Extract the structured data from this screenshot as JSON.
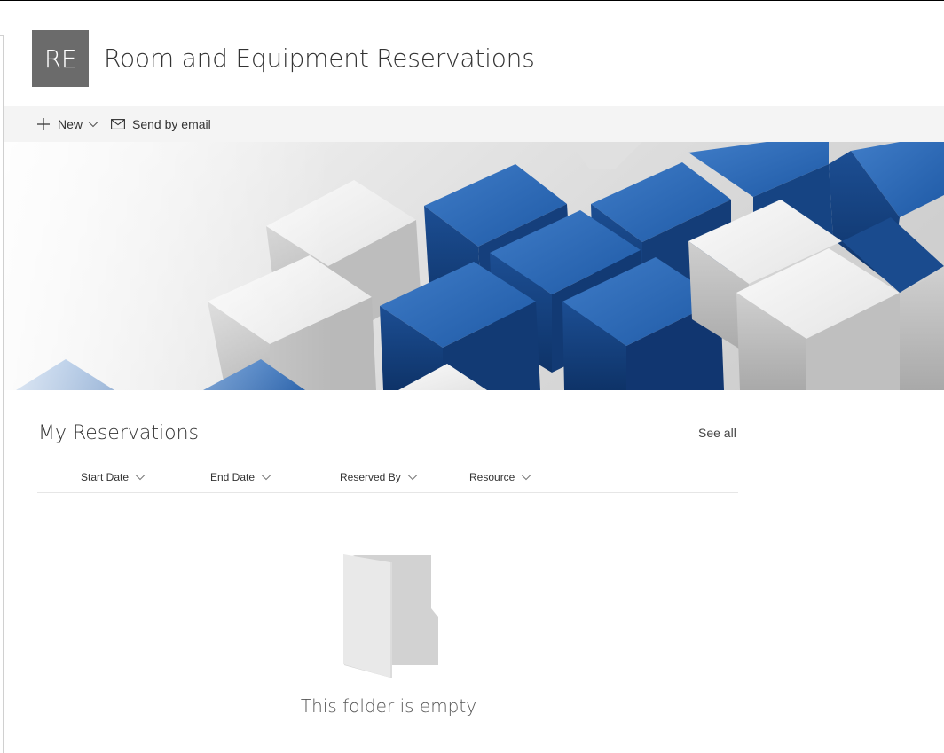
{
  "site": {
    "logo_initials": "RE",
    "title": "Room and Equipment Reservations",
    "logo_color": "#6b6b6b"
  },
  "command_bar": {
    "new_label": "New",
    "send_email_label": "Send by email",
    "icons": [
      "add-icon",
      "chevron-down-icon",
      "mail-icon"
    ]
  },
  "hero": {
    "image": "blue-and-white-cubes-banner",
    "colors": {
      "blue": "#1f5aa6",
      "white": "#e9e9e9"
    }
  },
  "reservations": {
    "title": "My Reservations",
    "see_all_label": "See all",
    "columns": [
      {
        "label": "Start Date"
      },
      {
        "label": "End Date"
      },
      {
        "label": "Reserved By"
      },
      {
        "label": "Resource"
      }
    ],
    "empty_message": "This folder is empty",
    "empty_icon": "empty-folder-icon"
  }
}
